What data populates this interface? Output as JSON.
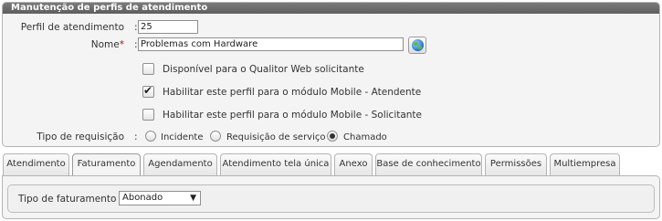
{
  "panel": {
    "title": "Manutenção de perfis de atendimento"
  },
  "form": {
    "perfil_label": "Perfil de atendimento",
    "perfil_value": "25",
    "nome_label": "Nome",
    "nome_required_mark": "*",
    "nome_value": "Problemas com Hardware",
    "colon": ":",
    "checkboxes": [
      {
        "label": "Disponível para o Qualitor Web solicitante",
        "checked": false
      },
      {
        "label": "Habilitar este perfil para o módulo Mobile - Atendente",
        "checked": true
      },
      {
        "label": "Habilitar este perfil para o módulo Mobile - Solicitante",
        "checked": false
      }
    ],
    "tipo_label": "Tipo de requisição",
    "radios": [
      {
        "label": "Incidente",
        "checked": false
      },
      {
        "label": "Requisição de serviço",
        "checked": false
      },
      {
        "label": "Chamado",
        "checked": true
      }
    ],
    "check_mark": "✔"
  },
  "tabs": [
    {
      "label": "Atendimento",
      "active": false
    },
    {
      "label": "Faturamento",
      "active": true
    },
    {
      "label": "Agendamento",
      "active": false
    },
    {
      "label": "Atendimento tela única",
      "active": false
    },
    {
      "label": "Anexo",
      "active": false
    },
    {
      "label": "Base de conhecimento",
      "active": false
    },
    {
      "label": "Permissões",
      "active": false
    },
    {
      "label": "Multiempresa",
      "active": false
    }
  ],
  "faturamento": {
    "label": "Tipo de faturamento",
    "colon": ":",
    "selected": "Abonado",
    "arrow": "▼"
  },
  "colors": {
    "title_bar": "#6b6b6b",
    "panel_bg": "#f4f4f4",
    "required": "#cc0000"
  }
}
